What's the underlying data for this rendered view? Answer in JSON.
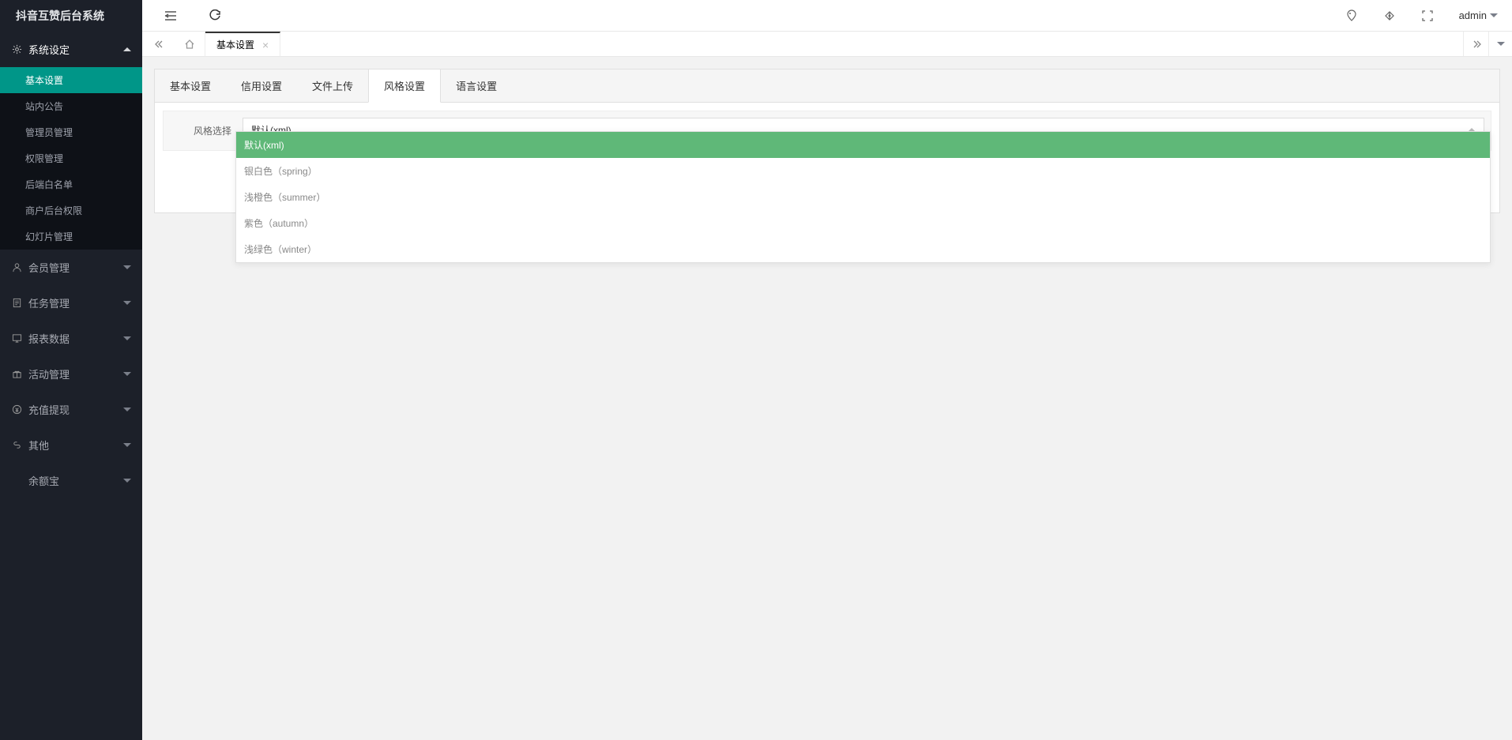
{
  "sidebar": {
    "title": "抖音互赞后台系统",
    "groups": [
      {
        "label": "系统设定",
        "expanded": true,
        "icon": "gear",
        "children": [
          {
            "label": "基本设置",
            "active": true
          },
          {
            "label": "站内公告"
          },
          {
            "label": "管理员管理"
          },
          {
            "label": "权限管理"
          },
          {
            "label": "后端白名单"
          },
          {
            "label": "商户后台权限"
          },
          {
            "label": "幻灯片管理"
          }
        ]
      },
      {
        "label": "会员管理",
        "icon": "user"
      },
      {
        "label": "任务管理",
        "icon": "doc"
      },
      {
        "label": "报表数据",
        "icon": "monitor"
      },
      {
        "label": "活动管理",
        "icon": "gift"
      },
      {
        "label": "充值提现",
        "icon": "coin"
      },
      {
        "label": "其他",
        "icon": "link"
      },
      {
        "label": "余额宝",
        "icon": ""
      }
    ]
  },
  "header": {
    "user": "admin"
  },
  "tabs": {
    "current": {
      "label": "基本设置"
    }
  },
  "innerTabs": [
    {
      "label": "基本设置"
    },
    {
      "label": "信用设置"
    },
    {
      "label": "文件上传"
    },
    {
      "label": "风格设置",
      "active": true
    },
    {
      "label": "语言设置"
    }
  ],
  "form": {
    "styleLabel": "风格选择",
    "selectedValue": "默认(xml)"
  },
  "dropdown": {
    "options": [
      {
        "label": "默认(xml)",
        "selected": true
      },
      {
        "label": "银白色（spring）"
      },
      {
        "label": "浅橙色（summer）"
      },
      {
        "label": "紫色（autumn）"
      },
      {
        "label": "浅绿色（winter）"
      }
    ]
  }
}
